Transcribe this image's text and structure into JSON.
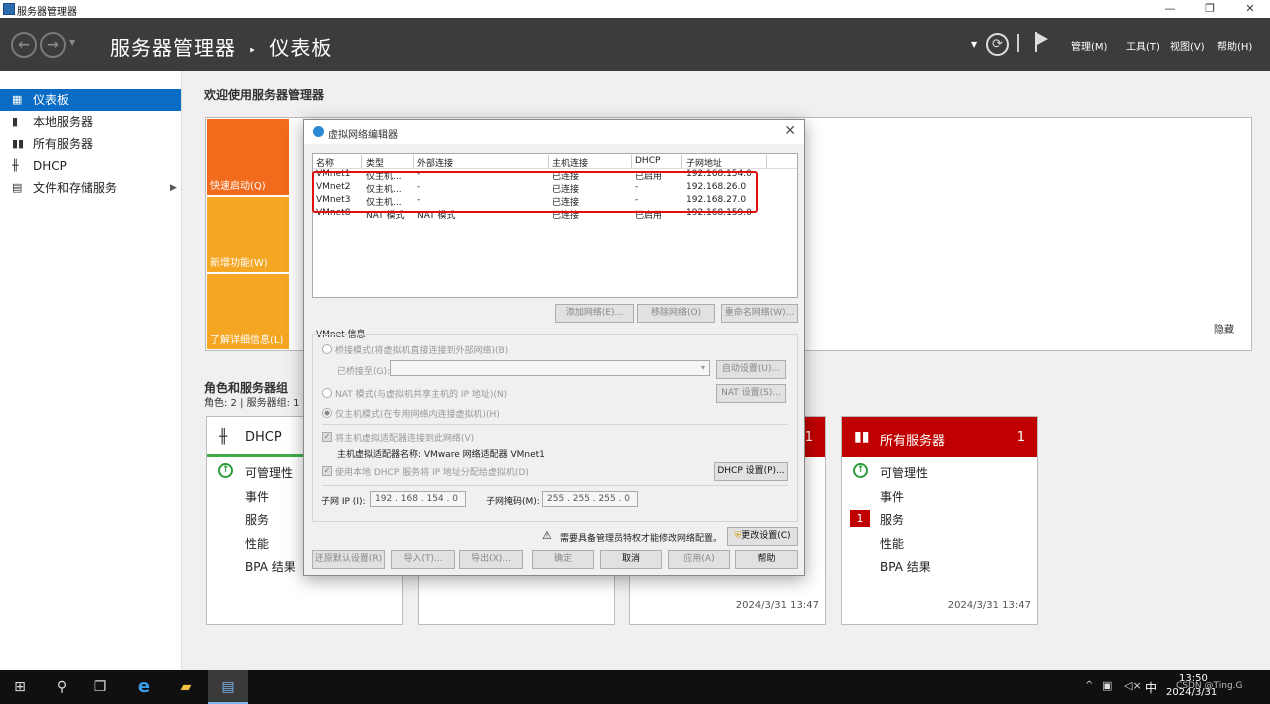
{
  "window": {
    "title": "服务器管理器",
    "min": "—",
    "max": "❐",
    "close": "✕"
  },
  "header": {
    "breadcrumb_root": "服务器管理器",
    "breadcrumb_sep": "‣",
    "breadcrumb_page": "仪表板",
    "menus": [
      "管理(M)",
      "工具(T)",
      "视图(V)",
      "帮助(H)"
    ]
  },
  "sidebar": {
    "items": [
      {
        "label": "仪表板",
        "icon": "dashboard-icon"
      },
      {
        "label": "本地服务器",
        "icon": "server-icon"
      },
      {
        "label": "所有服务器",
        "icon": "servers-icon"
      },
      {
        "label": "DHCP",
        "icon": "dhcp-icon"
      },
      {
        "label": "文件和存储服务",
        "icon": "storage-icon"
      }
    ],
    "expand": "▶"
  },
  "main": {
    "welcome": "欢迎使用服务器管理器",
    "tiles": [
      "快速启动(Q)",
      "新增功能(W)",
      "了解详细信息(L)"
    ],
    "hide": "隐藏",
    "roles_title": "角色和服务器组",
    "roles_sub": "角色: 2 | 服务器组: 1 |",
    "cards": [
      {
        "title": "DHCP",
        "count": "",
        "rows": [
          "可管理性",
          "事件",
          "服务",
          "性能",
          "BPA 结果"
        ],
        "time": ""
      },
      {
        "title": "",
        "count": "1",
        "rows": [],
        "time": "2024/3/31 13:47"
      },
      {
        "title": "所有服务器",
        "count": "1",
        "badge": "1",
        "rows": [
          "可管理性",
          "事件",
          "服务",
          "性能",
          "BPA 结果"
        ],
        "time": "2024/3/31 13:47"
      }
    ]
  },
  "dialog": {
    "title": "虚拟网络编辑器",
    "columns": [
      "名称",
      "类型",
      "外部连接",
      "主机连接",
      "DHCP",
      "子网地址"
    ],
    "rows": [
      [
        "VMnet1",
        "仅主机...",
        "-",
        "已连接",
        "已启用",
        "192.168.154.0"
      ],
      [
        "VMnet2",
        "仅主机...",
        "-",
        "已连接",
        "-",
        "192.168.26.0"
      ],
      [
        "VMnet3",
        "仅主机...",
        "-",
        "已连接",
        "-",
        "192.168.27.0"
      ],
      [
        "VMnet8",
        "NAT 模式",
        "NAT 模式",
        "已连接",
        "已启用",
        "192.168.159.0"
      ]
    ],
    "btn_add": "添加网络(E)...",
    "btn_remove": "移除网络(O)",
    "btn_rename": "重命名网络(W)...",
    "info_title": "VMnet 信息",
    "bridge_mode": "桥接模式(将虚拟机直接连接到外部网络)(B)",
    "bridged_to": "已桥接至(G):",
    "auto_settings": "自动设置(U)...",
    "nat_mode": "NAT 模式(与虚拟机共享主机的 IP 地址)(N)",
    "nat_settings": "NAT 设置(S)...",
    "host_only": "仅主机模式(在专用网络内连接虚拟机)(H)",
    "connect_adapter": "将主机虚拟适配器连接到此网络(V)",
    "adapter_name": "主机虚拟适配器名称: VMware 网络适配器 VMnet1",
    "use_dhcp": "使用本地 DHCP 服务将 IP 地址分配给虚拟机(D)",
    "dhcp_settings": "DHCP 设置(P)...",
    "subnet_ip_label": "子网 IP (I):",
    "subnet_ip": "192 . 168 . 154 .  0",
    "mask_label": "子网掩码(M):",
    "mask": "255 . 255 . 255 .  0",
    "admin_note": "需要具备管理员特权才能修改网络配置。",
    "change_settings": "更改设置(C)",
    "restore": "还原默认设置(R)",
    "import": "导入(T)...",
    "export": "导出(X)...",
    "ok": "确定",
    "cancel": "取消",
    "apply": "应用(A)",
    "help": "帮助"
  },
  "taskbar": {
    "time": "13:50",
    "date": "2024/3/31",
    "ime": "中",
    "watermark": "CSDN @Ting.G"
  }
}
